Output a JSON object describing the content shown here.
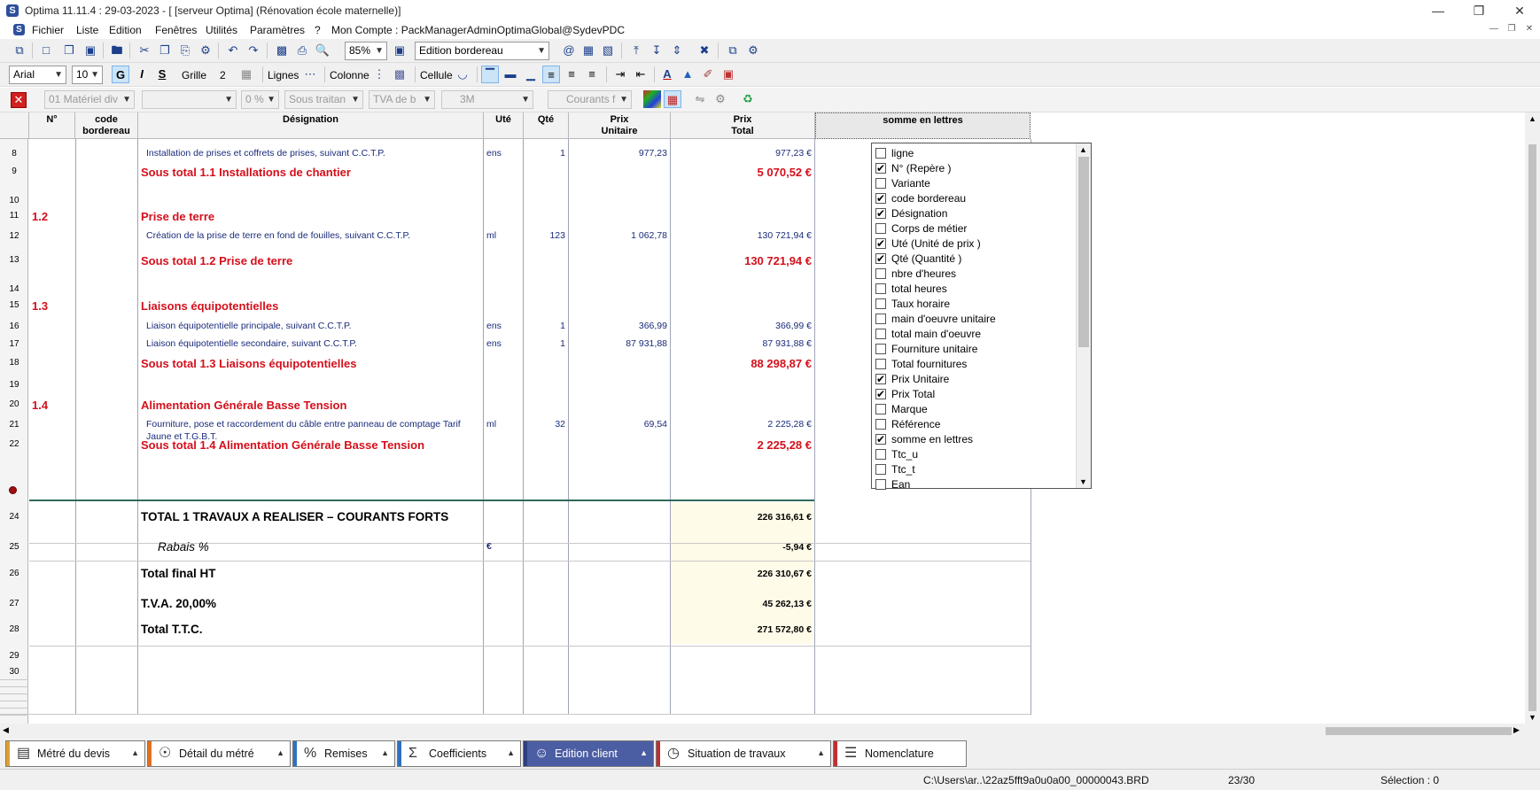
{
  "window": {
    "title": "Optima 11.11.4 : 29-03-2023 - [ [serveur Optima] (Rénovation école maternelle)]",
    "logo": "S"
  },
  "menu": {
    "items": [
      "Fichier",
      "Liste",
      "Edition",
      "Fenêtres",
      "Utilités",
      "Paramètres",
      "?",
      "Mon Compte : PackManagerAdminOptimaGlobal@SydevPDC"
    ]
  },
  "toolbar1": {
    "zoom": "85%",
    "mode": "Edition bordereau"
  },
  "toolbar2": {
    "font": "Arial",
    "size": "10",
    "bold": "G",
    "italic": "I",
    "strike": "S",
    "grid_label": "Grille",
    "grid_value": "2",
    "lines_label": "Lignes",
    "columns_label": "Colonne",
    "cell_label": "Cellule"
  },
  "toolbar3": {
    "combo1": "01  Matériel div",
    "combo2": "",
    "combo3": "0 %",
    "combo4": "Sous traitan",
    "combo5": "TVA de b",
    "combo6": "3M",
    "combo7": "Courants f"
  },
  "grid": {
    "headers": {
      "num": "N°",
      "code": "code\nbordereau",
      "designation": "Désignation",
      "ute": "Uté",
      "qte": "Qté",
      "pu": "Prix\nUnitaire",
      "pt": "Prix\nTotal",
      "lettres": "somme en lettres"
    },
    "rows": [
      {
        "n": "8",
        "num": "",
        "des": "Installation de prises et coffrets de prises, suivant C.C.T.P.",
        "ute": "ens",
        "qte": "1",
        "pu": "977,23",
        "pt": "977,23 €",
        "style": "d"
      },
      {
        "n": "9",
        "num": "",
        "des": "Sous total 1.1 Installations de chantier",
        "ute": "",
        "qte": "",
        "pu": "",
        "pt": "5 070,52 €",
        "style": "red"
      },
      {
        "n": "10",
        "num": "",
        "des": "",
        "ute": "",
        "qte": "",
        "pu": "",
        "pt": "",
        "style": "d"
      },
      {
        "n": "11",
        "num": "1.2",
        "des": "Prise de terre",
        "ute": "",
        "qte": "",
        "pu": "",
        "pt": "",
        "style": "red"
      },
      {
        "n": "12",
        "num": "",
        "des": "Création de la prise de terre en fond de fouilles, suivant C.C.T.P.",
        "ute": "ml",
        "qte": "123",
        "pu": "1 062,78",
        "pt": "130 721,94 €",
        "style": "d"
      },
      {
        "n": "13",
        "num": "",
        "des": "Sous total 1.2 Prise de terre",
        "ute": "",
        "qte": "",
        "pu": "",
        "pt": "130 721,94 €",
        "style": "red"
      },
      {
        "n": "14",
        "num": "",
        "des": "",
        "ute": "",
        "qte": "",
        "pu": "",
        "pt": "",
        "style": "d"
      },
      {
        "n": "15",
        "num": "1.3",
        "des": "Liaisons équipotentielles",
        "ute": "",
        "qte": "",
        "pu": "",
        "pt": "",
        "style": "red"
      },
      {
        "n": "16",
        "num": "",
        "des": "Liaison équipotentielle principale, suivant C.C.T.P.",
        "ute": "ens",
        "qte": "1",
        "pu": "366,99",
        "pt": "366,99 €",
        "style": "d"
      },
      {
        "n": "17",
        "num": "",
        "des": "Liaison équipotentielle secondaire, suivant C.C.T.P.",
        "ute": "ens",
        "qte": "1",
        "pu": "87 931,88",
        "pt": "87 931,88 €",
        "style": "d"
      },
      {
        "n": "18",
        "num": "",
        "des": "Sous total 1.3 Liaisons équipotentielles",
        "ute": "",
        "qte": "",
        "pu": "",
        "pt": "88 298,87 €",
        "style": "red"
      },
      {
        "n": "19",
        "num": "",
        "des": "",
        "ute": "",
        "qte": "",
        "pu": "",
        "pt": "",
        "style": "d"
      },
      {
        "n": "20",
        "num": "1.4",
        "des": "Alimentation Générale Basse Tension",
        "ute": "",
        "qte": "",
        "pu": "",
        "pt": "",
        "style": "red"
      },
      {
        "n": "21",
        "num": "",
        "des": "Fourniture, pose et raccordement du câble entre panneau de comptage Tarif",
        "des2": "Jaune et T.G.B.T.",
        "ute": "ml",
        "qte": "32",
        "pu": "69,54",
        "pt": "2 225,28 €",
        "style": "d"
      },
      {
        "n": "22",
        "num": "",
        "des": "Sous total 1.4 Alimentation Générale Basse Tension",
        "ute": "",
        "qte": "",
        "pu": "",
        "pt": "2 225,28 €",
        "style": "red"
      },
      {
        "n": "",
        "num": "",
        "des": "",
        "ute": "",
        "qte": "",
        "pu": "",
        "pt": "",
        "style": "d"
      }
    ],
    "totals": [
      {
        "n": "24",
        "label": "TOTAL 1 TRAVAUX A REALISER – COURANTS FORTS",
        "ute": "",
        "pt": "226 316,61 €"
      },
      {
        "n": "25",
        "label": "Rabais %",
        "ute": "€",
        "pt": "-5,94 €"
      },
      {
        "n": "26",
        "label": "Total final HT",
        "ute": "",
        "pt": "226 310,67 €"
      },
      {
        "n": "27",
        "label": "T.V.A. 20,00%",
        "ute": "",
        "pt": "45 262,13 €"
      },
      {
        "n": "28",
        "label": "Total  T.T.C.",
        "ute": "",
        "pt": "271 572,80 €"
      },
      {
        "n": "29",
        "label": "",
        "ute": "",
        "pt": ""
      },
      {
        "n": "30",
        "label": "",
        "ute": "",
        "pt": ""
      }
    ]
  },
  "column_picker": {
    "items": [
      {
        "label": "ligne",
        "checked": false
      },
      {
        "label": "N° (Repère )",
        "checked": true
      },
      {
        "label": "Variante",
        "checked": false
      },
      {
        "label": "code bordereau",
        "checked": true
      },
      {
        "label": "Désignation",
        "checked": true
      },
      {
        "label": "Corps de métier",
        "checked": false
      },
      {
        "label": "Uté (Unité de prix )",
        "checked": true
      },
      {
        "label": "Qté (Quantité )",
        "checked": true
      },
      {
        "label": "nbre d'heures",
        "checked": false
      },
      {
        "label": "total heures",
        "checked": false
      },
      {
        "label": "Taux horaire",
        "checked": false
      },
      {
        "label": "main d'oeuvre unitaire",
        "checked": false
      },
      {
        "label": "total main d'oeuvre",
        "checked": false
      },
      {
        "label": "Fourniture unitaire",
        "checked": false
      },
      {
        "label": "Total fournitures",
        "checked": false
      },
      {
        "label": "Prix Unitaire",
        "checked": true
      },
      {
        "label": "Prix Total",
        "checked": true
      },
      {
        "label": "Marque",
        "checked": false
      },
      {
        "label": "Référence",
        "checked": false
      },
      {
        "label": "somme en lettres",
        "checked": true
      },
      {
        "label": "Ttc_u",
        "checked": false
      },
      {
        "label": "Ttc_t",
        "checked": false
      },
      {
        "label": "Ean",
        "checked": false
      }
    ]
  },
  "tabs": [
    {
      "label": "Métré du devis",
      "icon": "document-icon",
      "color": "#e0a030",
      "selected": false
    },
    {
      "label": "Détail du métré",
      "icon": "eye-icon",
      "color": "#e07020",
      "selected": false
    },
    {
      "label": "Remises",
      "icon": "percent-icon",
      "color": "#3070c0",
      "selected": false
    },
    {
      "label": "Coefficients",
      "icon": "sigma-icon",
      "color": "#3070c0",
      "selected": false
    },
    {
      "label": "Edition client",
      "icon": "user-icon",
      "color": "#4b5ea3",
      "selected": true
    },
    {
      "label": "Situation de travaux",
      "icon": "clock-icon",
      "color": "#c03030",
      "selected": false
    },
    {
      "label": "Nomenclature",
      "icon": "list-icon",
      "color": "#c03030",
      "selected": false
    }
  ],
  "status": {
    "path": "C:\\Users\\ar..\\22az5fft9a0u0a00_00000043.BRD",
    "position": "23/30",
    "selection": "Sélection : 0"
  }
}
